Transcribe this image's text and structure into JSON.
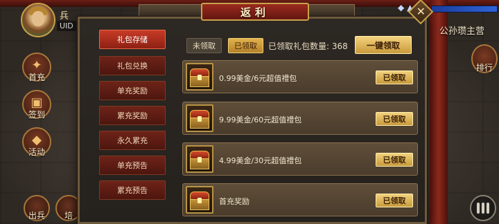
{
  "hud": {
    "id_label": "UID",
    "top_label": "兵",
    "side_buttons": [
      {
        "label": "首充",
        "icon": "gift-icon"
      },
      {
        "label": "签到",
        "icon": "calendar-icon"
      },
      {
        "label": "活动",
        "icon": "lantern-icon"
      }
    ],
    "bottom_buttons": [
      {
        "label": "出兵",
        "icon": "troops-icon"
      },
      {
        "label": "培",
        "icon": "train-icon"
      }
    ],
    "location": "公孙瓒主营",
    "rank_label": "排行"
  },
  "modal": {
    "title": "返利",
    "close_glyph": "✕",
    "tabs": [
      {
        "label": "礼包存储",
        "active": true
      },
      {
        "label": "礼包兑换",
        "active": false
      },
      {
        "label": "单充奖励",
        "active": false
      },
      {
        "label": "累充奖励",
        "active": false
      },
      {
        "label": "永久累充",
        "active": false
      },
      {
        "label": "单充预告",
        "active": false
      },
      {
        "label": "累充预告",
        "active": false
      }
    ],
    "filters": {
      "unclaimed": "未领取",
      "claimed": "已领取"
    },
    "claimed_count_text": "已领取礼包数量: 368",
    "claim_all_label": "一键领取",
    "rows": [
      {
        "name": "0.99美金/6元超值禮包",
        "status": "已领取"
      },
      {
        "name": "9.99美金/60元超值禮包",
        "status": "已领取"
      },
      {
        "name": "4.99美金/30元超值禮包",
        "status": "已领取"
      },
      {
        "name": "首充奖励",
        "status": "已领取"
      }
    ]
  },
  "colors": {
    "accent_gold": "#f1d07c",
    "tab_active": "#c73a26",
    "tab_inactive": "#6e2318",
    "panel_bg": "#2d2823"
  }
}
